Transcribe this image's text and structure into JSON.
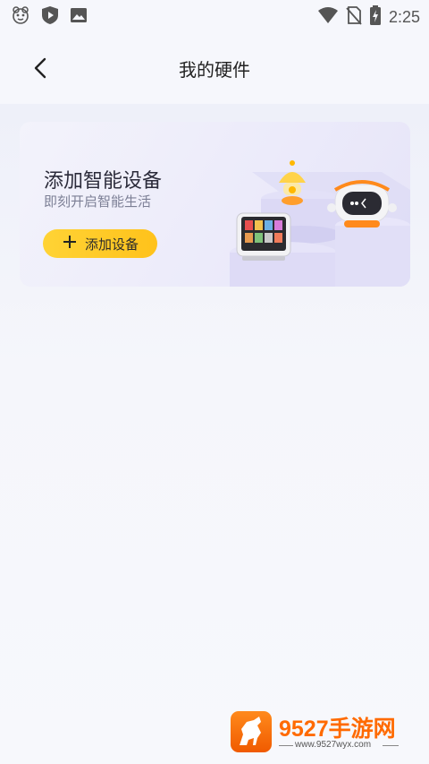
{
  "status_bar": {
    "time": "2:25",
    "icons": [
      "app-mascot-icon",
      "play-shield-icon",
      "image-icon",
      "wifi-icon",
      "no-sim-icon",
      "battery-charging-icon"
    ]
  },
  "header": {
    "title": "我的硬件",
    "back_icon": "chevron-left-icon"
  },
  "card": {
    "title": "添加智能设备",
    "subtitle": "即刻开启智能生活",
    "button_label": "添加设备",
    "button_icon": "plus-icon",
    "button_color": "#ffc928",
    "illustration": "smart-devices-illustration"
  },
  "watermark": {
    "title": "9527手游网",
    "url": "www.9527wyx.com"
  }
}
